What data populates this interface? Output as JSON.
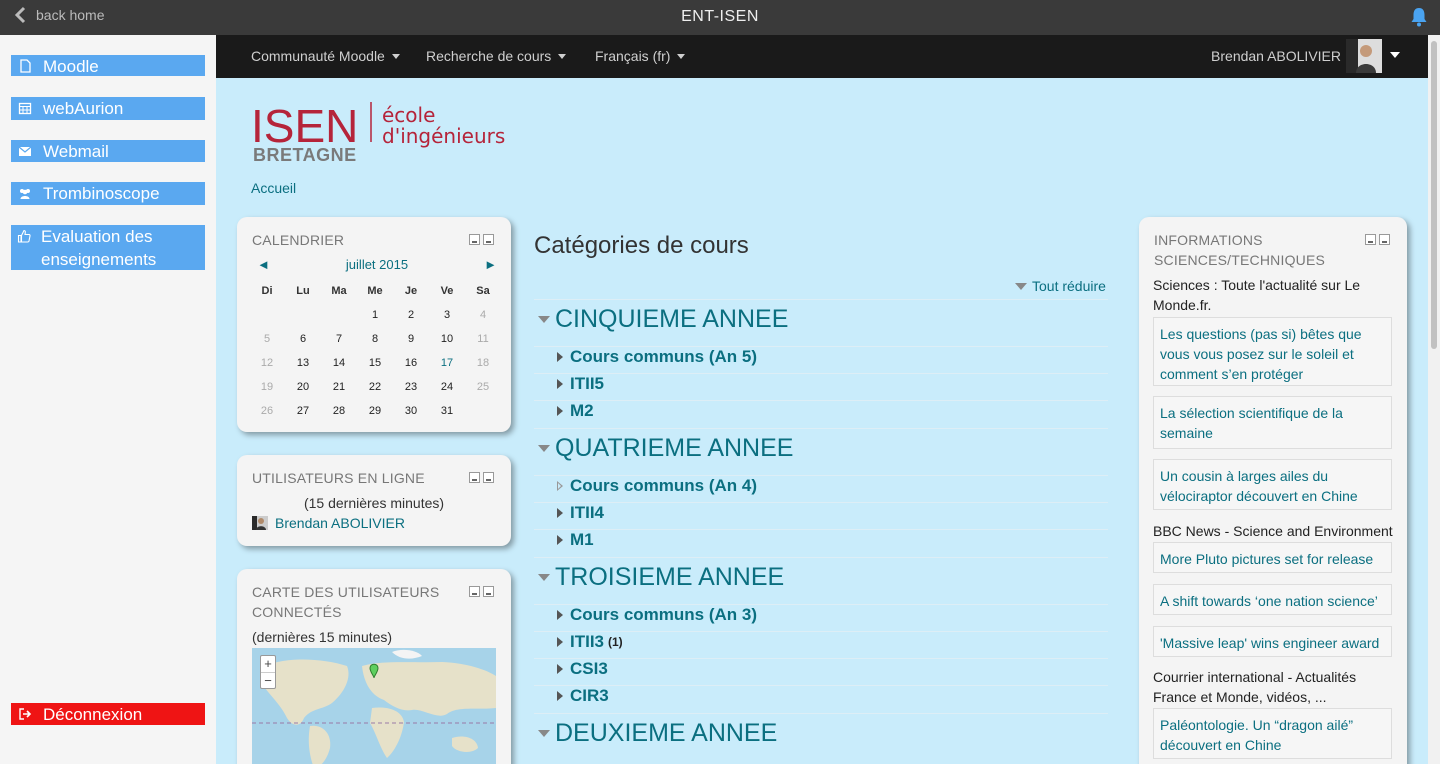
{
  "appbar": {
    "back_label": "back home",
    "title": "ENT-ISEN"
  },
  "sidemenu": {
    "items": [
      {
        "label": "Moodle"
      },
      {
        "label": "webAurion"
      },
      {
        "label": "Webmail"
      },
      {
        "label": "Trombinoscope"
      },
      {
        "label": "Evaluation des enseignements"
      }
    ],
    "logout": "Déconnexion"
  },
  "navbar": {
    "menus": [
      "Communauté Moodle",
      "Recherche de cours",
      "Français (fr)"
    ],
    "user": "Brendan ABOLIVIER"
  },
  "logo": {
    "isen": "ISEN",
    "bretagne": "BRETAGNE",
    "ecole": "école",
    "ingenieurs": "d'ingénieurs"
  },
  "breadcrumb": "Accueil",
  "calendar": {
    "title": "CALENDRIER",
    "month": "juillet 2015",
    "prev": "◄",
    "next": "►",
    "days": [
      "Di",
      "Lu",
      "Ma",
      "Me",
      "Je",
      "Ve",
      "Sa"
    ],
    "weeks": [
      [
        "",
        "",
        "",
        "1",
        "2",
        "3",
        "4"
      ],
      [
        "5",
        "6",
        "7",
        "8",
        "9",
        "10",
        "11"
      ],
      [
        "12",
        "13",
        "14",
        "15",
        "16",
        "17",
        "18"
      ],
      [
        "19",
        "20",
        "21",
        "22",
        "23",
        "24",
        "25"
      ],
      [
        "26",
        "27",
        "28",
        "29",
        "30",
        "31",
        ""
      ]
    ],
    "today": "17"
  },
  "online": {
    "title": "UTILISATEURS EN LIGNE",
    "subtitle": "(15 dernières minutes)",
    "user": "Brendan ABOLIVIER"
  },
  "map": {
    "title": "CARTE DES UTILISATEURS CONNECTÉS",
    "subtitle": "(dernières 15 minutes)",
    "zoom_in": "+",
    "zoom_out": "−"
  },
  "categories": {
    "title": "Catégories de cours",
    "collapse_all": "Tout réduire",
    "years": [
      {
        "label": "CINQUIEME ANNEE",
        "subs": [
          {
            "label": "Cours communs (An 5)",
            "empty": false,
            "count": ""
          },
          {
            "label": "ITII5",
            "empty": false,
            "count": ""
          },
          {
            "label": "M2",
            "empty": false,
            "count": ""
          }
        ]
      },
      {
        "label": "QUATRIEME ANNEE",
        "subs": [
          {
            "label": "Cours communs (An 4)",
            "empty": true,
            "count": ""
          },
          {
            "label": "ITII4",
            "empty": false,
            "count": ""
          },
          {
            "label": "M1",
            "empty": false,
            "count": ""
          }
        ]
      },
      {
        "label": "TROISIEME ANNEE",
        "subs": [
          {
            "label": "Cours communs (An 3)",
            "empty": false,
            "count": ""
          },
          {
            "label": "ITII3",
            "empty": false,
            "count": "(1)"
          },
          {
            "label": "CSI3",
            "empty": false,
            "count": ""
          },
          {
            "label": "CIR3",
            "empty": false,
            "count": ""
          }
        ]
      },
      {
        "label": "DEUXIEME ANNEE",
        "subs": []
      }
    ]
  },
  "news": {
    "title": "INFORMATIONS SCIENCES/TECHNIQUES",
    "source1": "Sciences : Toute l'actualité sur Le Monde.fr.",
    "items1": [
      "Les questions (pas si) bêtes que vous vous posez sur le soleil et comment s’en protéger",
      "La sélection scientifique de la semaine",
      "Un cousin à larges ailes du vélociraptor découvert en Chine"
    ],
    "source2": "BBC News - Science and Environment",
    "items2": [
      "More Pluto pictures set for release",
      "A shift towards ‘one nation science’",
      "'Massive leap' wins engineer award"
    ],
    "source3": "Courrier international - Actualités France et Monde, vidéos, ...",
    "items3": [
      "Paléontologie. Un “dragon ailé” découvert en Chine"
    ]
  }
}
